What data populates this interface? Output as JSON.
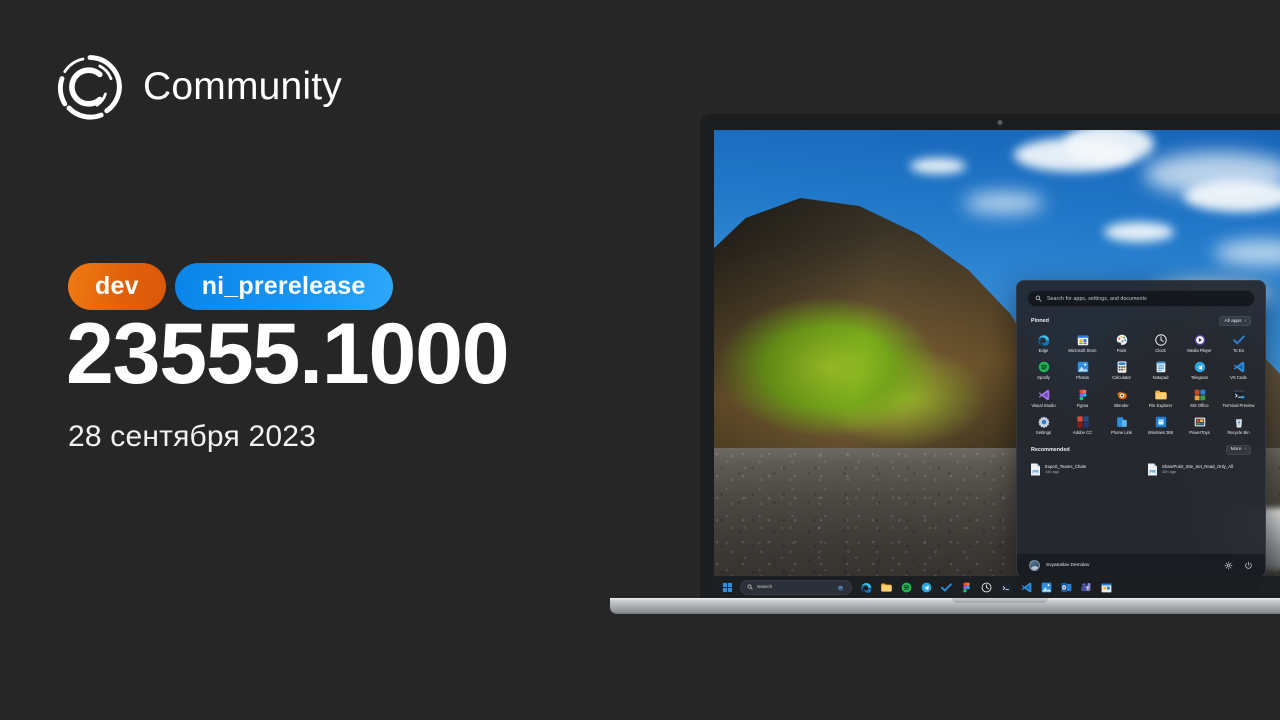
{
  "brand": {
    "logo_icon": "community-ring-c-icon",
    "name": "Community"
  },
  "release": {
    "badges": [
      {
        "label": "dev",
        "color": "#e2610a",
        "icon": "dev-channel-badge"
      },
      {
        "label": "ni_prerelease",
        "color": "#1694f5",
        "icon": "ni-prerelease-badge"
      }
    ],
    "build_number": "23555.1000",
    "date": "28 сентября 2023"
  },
  "device": {
    "type": "laptop-mockup",
    "webcam_icon": "webcam-icon"
  },
  "start_menu": {
    "search": {
      "placeholder": "Search for apps, settings, and documents",
      "value": "",
      "icon": "search-icon"
    },
    "pinned": {
      "title": "Pinned",
      "all_apps_label": "All apps",
      "all_apps_icon": "chevron-right-icon",
      "apps": [
        {
          "label": "Edge",
          "icon": "edge-icon"
        },
        {
          "label": "Microsoft Store",
          "icon": "microsoft-store-icon"
        },
        {
          "label": "Paint",
          "icon": "paint-icon"
        },
        {
          "label": "Clock",
          "icon": "clock-icon"
        },
        {
          "label": "Media Player",
          "icon": "media-player-icon"
        },
        {
          "label": "To Do",
          "icon": "to-do-icon"
        },
        {
          "label": "Spotify",
          "icon": "spotify-icon"
        },
        {
          "label": "Photos",
          "icon": "photos-icon"
        },
        {
          "label": "Calculator",
          "icon": "calculator-icon"
        },
        {
          "label": "Notepad",
          "icon": "notepad-icon"
        },
        {
          "label": "Telegram",
          "icon": "telegram-icon"
        },
        {
          "label": "VS Code",
          "icon": "vs-code-icon"
        },
        {
          "label": "Visual Studio",
          "icon": "visual-studio-icon"
        },
        {
          "label": "Figma",
          "icon": "figma-icon"
        },
        {
          "label": "Blender",
          "icon": "blender-icon"
        },
        {
          "label": "File Explorer",
          "icon": "file-explorer-icon"
        },
        {
          "label": "MS Office",
          "icon": "ms-office-icon"
        },
        {
          "label": "Terminal Preview",
          "icon": "terminal-preview-icon"
        },
        {
          "label": "Settings",
          "icon": "settings-gear-icon"
        },
        {
          "label": "Adobe CC",
          "icon": "adobe-cc-icon"
        },
        {
          "label": "Phone Link",
          "icon": "phone-link-icon"
        },
        {
          "label": "Windows 365",
          "icon": "windows-365-icon"
        },
        {
          "label": "PowerToys",
          "icon": "powertoys-icon"
        },
        {
          "label": "Recycle Bin",
          "icon": "recycle-bin-icon"
        }
      ]
    },
    "recommended": {
      "title": "Recommended",
      "more_label": "More",
      "more_icon": "chevron-right-icon",
      "items": [
        {
          "name": "Export_Teams_Chats",
          "time": "14h ago",
          "icon": "document-file-icon"
        },
        {
          "name": "SharePoint_Site_Set_Read_Only_All",
          "time": "10h ago",
          "icon": "document-file-icon"
        }
      ]
    },
    "account": {
      "user_name": "Svyatoslav Demidov",
      "avatar_icon": "avatar",
      "settings_icon": "gear-icon",
      "power_icon": "power-icon"
    }
  },
  "taskbar": {
    "start_icon": "windows-start-icon",
    "search": {
      "placeholder": "Search",
      "value": "",
      "icon": "search-icon",
      "copilot_icon": "copilot-icon"
    },
    "apps": [
      {
        "label": "Edge",
        "icon": "edge-icon"
      },
      {
        "label": "File Explorer",
        "icon": "file-explorer-icon"
      },
      {
        "label": "Spotify",
        "icon": "spotify-icon"
      },
      {
        "label": "Telegram",
        "icon": "telegram-icon"
      },
      {
        "label": "To Do",
        "icon": "to-do-icon"
      },
      {
        "label": "Figma",
        "icon": "figma-icon"
      },
      {
        "label": "Clock",
        "icon": "clock-icon"
      },
      {
        "label": "Terminal",
        "icon": "terminal-preview-icon"
      },
      {
        "label": "VS Code",
        "icon": "vs-code-icon"
      },
      {
        "label": "Photos",
        "icon": "photos-icon"
      },
      {
        "label": "Outlook",
        "icon": "outlook-icon"
      },
      {
        "label": "Teams",
        "icon": "teams-icon"
      },
      {
        "label": "Store",
        "icon": "microsoft-store-icon"
      }
    ]
  },
  "wallpaper": {
    "description": "Coastal cliff with green moss and black pebble beach under blue sky"
  }
}
